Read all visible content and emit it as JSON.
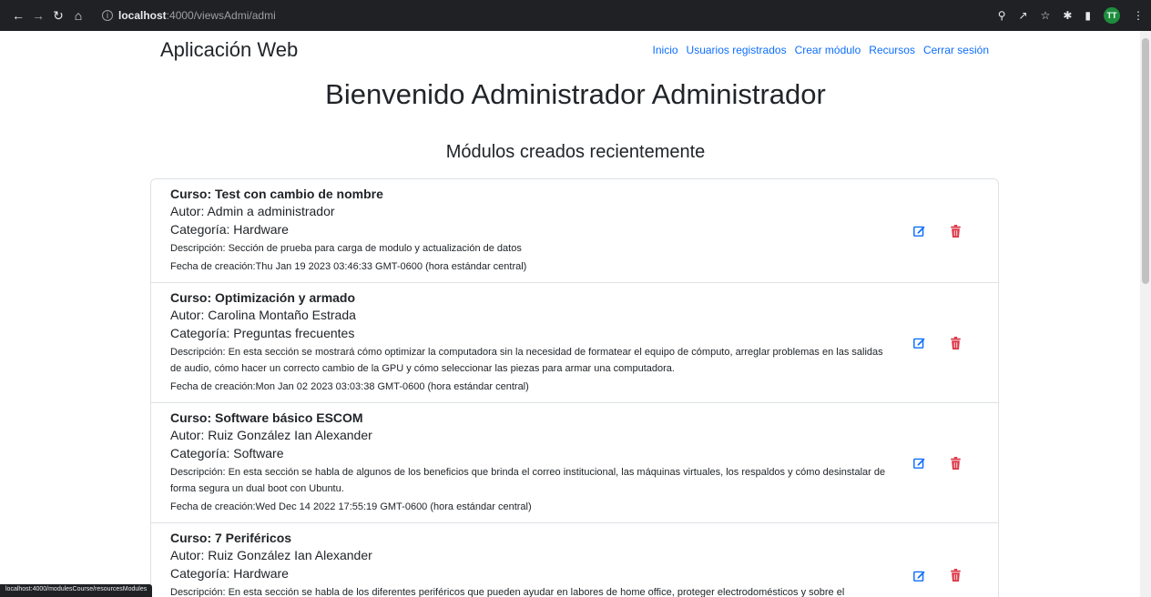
{
  "browser": {
    "url_host": "localhost",
    "url_path": ":4000/viewsAdmi/admi",
    "profile_initials": "TT",
    "status_url": "localhost:4000/modulesCourse/resourcesModules"
  },
  "header": {
    "brand": "Aplicación Web",
    "nav": [
      "Inicio",
      "Usuarios registrados",
      "Crear módulo",
      "Recursos",
      "Cerrar sesión"
    ]
  },
  "welcome": "Bienvenido Administrador Administrador",
  "subtitle": "Módulos creados recientemente",
  "modules": [
    {
      "course": "Curso: Test con cambio de nombre",
      "author": "Autor: Admin a administrador",
      "category": "Categoría: Hardware",
      "description": "Descripción: Sección de prueba para carga de modulo y actualización de datos",
      "date": "Fecha de creación:Thu Jan 19 2023 03:46:33 GMT-0600 (hora estándar central)"
    },
    {
      "course": "Curso: Optimización y armado",
      "author": "Autor: Carolina Montaño Estrada",
      "category": "Categoría: Preguntas frecuentes",
      "description": "Descripción: En esta sección se mostrará cómo optimizar la computadora sin la necesidad de formatear el equipo de cómputo, arreglar problemas en las salidas de audio, cómo hacer un correcto cambio de la GPU y cómo seleccionar las piezas para armar una computadora.",
      "date": "Fecha de creación:Mon Jan 02 2023 03:03:38 GMT-0600 (hora estándar central)"
    },
    {
      "course": "Curso: Software básico ESCOM",
      "author": "Autor: Ruiz González Ian Alexander",
      "category": "Categoría: Software",
      "description": "Descripción: En esta sección se habla de algunos de los beneficios que brinda el correo institucional, las máquinas virtuales, los respaldos y cómo desinstalar de forma segura un dual boot con Ubuntu.",
      "date": "Fecha de creación:Wed Dec 14 2022 17:55:19 GMT-0600 (hora estándar central)"
    },
    {
      "course": "Curso: 7 Periféricos",
      "author": "Autor: Ruiz González Ian Alexander",
      "category": "Categoría: Hardware",
      "description": "Descripción: En esta sección se habla de los diferentes periféricos que pueden ayudar en labores de home office, proteger electrodomésticos y sobre el",
      "date": ""
    }
  ],
  "colors": {
    "link": "#0d6efd",
    "edit": "#0d6efd",
    "delete": "#dc3545"
  },
  "icons": {
    "edit": "pencil-square-icon",
    "delete": "trash-icon"
  }
}
